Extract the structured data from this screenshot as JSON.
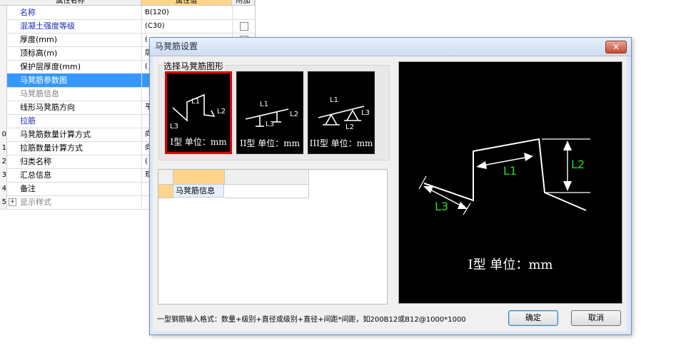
{
  "background_grid": {
    "header": {
      "col_name": "属性名称",
      "col_value": "属性值",
      "col_extra": "附加"
    },
    "rows": [
      {
        "num": "",
        "name": "名称",
        "value": "B(120)",
        "style": "blue",
        "checkbox": false
      },
      {
        "num": "",
        "name": "混凝土强度等级",
        "value": "(C30)",
        "style": "blue",
        "checkbox": true
      },
      {
        "num": "",
        "name": "厚度(mm)",
        "value": "(",
        "style": "normal",
        "checkbox": true
      },
      {
        "num": "",
        "name": "顶标高(m)",
        "value": "层",
        "style": "normal",
        "checkbox": false
      },
      {
        "num": "",
        "name": "保护层厚度(mm)",
        "value": "(",
        "style": "normal",
        "checkbox": false
      },
      {
        "num": "",
        "name": "马凳筋参数图",
        "value": "",
        "style": "selected",
        "checkbox": false
      },
      {
        "num": "",
        "name": "马凳筋信息",
        "value": "",
        "style": "gray",
        "checkbox": false
      },
      {
        "num": "",
        "name": "线形马凳筋方向",
        "value": "平",
        "style": "normal",
        "checkbox": false
      },
      {
        "num": "",
        "name": "拉筋",
        "value": "",
        "style": "blue",
        "checkbox": false
      },
      {
        "num": "0",
        "name": "马凳筋数量计算方式",
        "value": "向",
        "style": "normal",
        "checkbox": false
      },
      {
        "num": "1",
        "name": "拉筋数量计算方式",
        "value": "向",
        "style": "normal",
        "checkbox": false
      },
      {
        "num": "2",
        "name": "归类名称",
        "value": "(",
        "style": "normal",
        "checkbox": false
      },
      {
        "num": "3",
        "name": "汇总信息",
        "value": "现",
        "style": "normal",
        "checkbox": false
      },
      {
        "num": "4",
        "name": "备注",
        "value": "",
        "style": "normal",
        "checkbox": false
      },
      {
        "num": "5",
        "name": "显示样式",
        "value": "",
        "style": "gray-expand",
        "checkbox": false
      }
    ]
  },
  "dialog": {
    "title": "马凳筋设置",
    "close_glyph": "✕",
    "group_label": "选择马凳筋图形",
    "shapes": [
      {
        "caption": "I型 单位：mm",
        "selected": true,
        "labels": [
          "L1",
          "L2",
          "L3"
        ]
      },
      {
        "caption": "II型 单位：mm",
        "selected": false,
        "labels": [
          "L1",
          "L2",
          "L3"
        ]
      },
      {
        "caption": "III型 单位：mm",
        "selected": false,
        "labels": [
          "L1",
          "L3",
          "L2"
        ]
      }
    ],
    "info_table": {
      "row_label": "马凳筋信息",
      "value": ""
    },
    "preview": {
      "caption": "I型 单位：mm",
      "labels": {
        "l1": "L1",
        "l2": "L2",
        "l3": "L3"
      },
      "label_color": "#22dd22"
    },
    "format_hint": "一型钢筋输入格式：数量+级别+直径或级别+直径+间距*间距，如200B12或B12@1000*1000",
    "ok_label": "确定",
    "cancel_label": "取消"
  }
}
